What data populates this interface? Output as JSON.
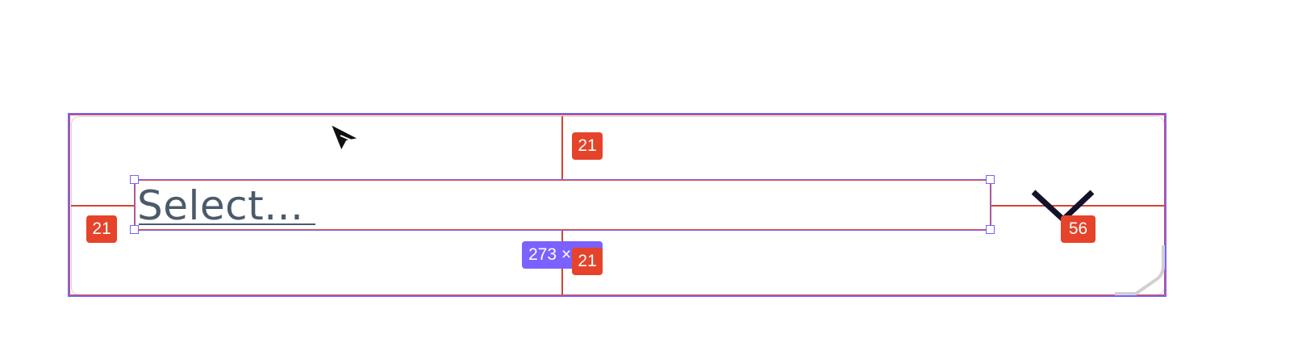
{
  "select": {
    "placeholder": "Select..."
  },
  "inspector": {
    "padding_top": "21",
    "padding_left": "21",
    "padding_bottom": "21",
    "padding_right": "56",
    "size_label": "273 ×"
  },
  "colors": {
    "selection": "#7b61ff",
    "spacing": "#e5432a",
    "placeholder_text": "#4b5a6b"
  },
  "icons": {
    "dropdown": "chevron-down-icon",
    "pointer": "cursor-icon",
    "grip": "resize-grip-icon"
  }
}
